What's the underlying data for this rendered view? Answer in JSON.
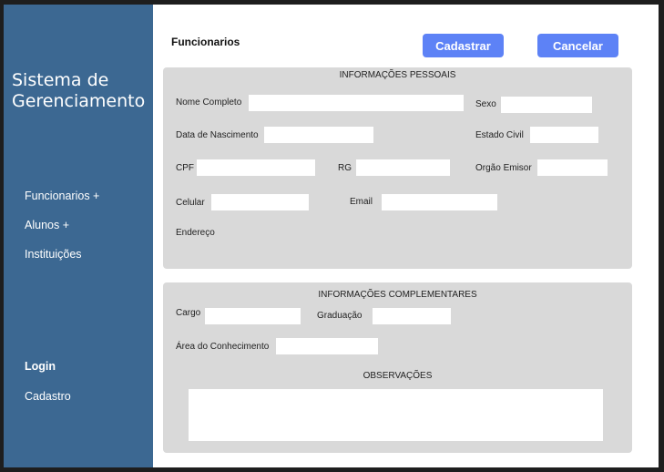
{
  "sidebar": {
    "app_title": "Sistema de Gerenciamento",
    "items": [
      {
        "label": "Funcionarios +"
      },
      {
        "label": "Alunos +"
      },
      {
        "label": "Instituições"
      }
    ],
    "login_label": "Login",
    "cadastro_label": "Cadastro"
  },
  "header": {
    "title": "Funcionarios",
    "cadastrar_label": "Cadastrar",
    "cancelar_label": "Cancelar"
  },
  "personal": {
    "title": "INFORMAÇÕES PESSOAIS",
    "nome_label": "Nome Completo",
    "sexo_label": "Sexo",
    "nascimento_label": "Data de Nascimento",
    "estado_civil_label": "Estado Civil",
    "cpf_label": "CPF",
    "rg_label": "RG",
    "orgao_label": "Orgão Emisor",
    "celular_label": "Celular",
    "email_label": "Email",
    "endereco_label": "Endereço"
  },
  "complement": {
    "title": "INFORMAÇÕES  COMPLEMENTARES",
    "cargo_label": "Cargo",
    "graduacao_label": "Graduação",
    "area_label": "Área do Conhecimento",
    "observacoes_label": "OBSERVAÇÕES"
  },
  "colors": {
    "sidebar": "#3c6892",
    "button": "#5d82f6",
    "panel": "#d9d9d9"
  }
}
